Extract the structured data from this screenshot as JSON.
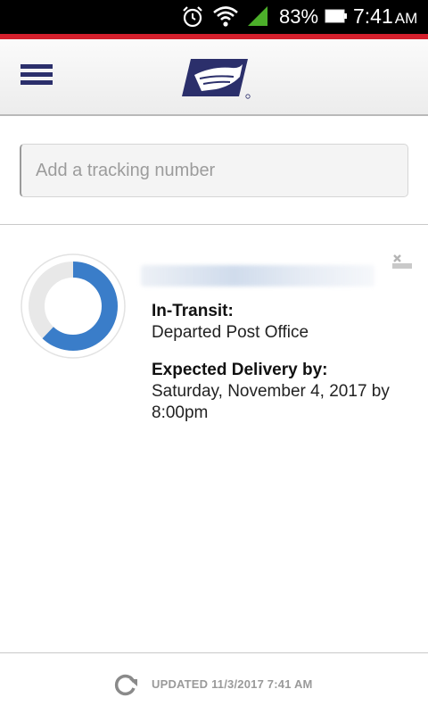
{
  "status_bar": {
    "battery_percent": "83%",
    "time": "7:41",
    "ampm": "AM",
    "icons": [
      "alarm-icon",
      "wifi-icon",
      "cell-signal-icon",
      "battery-icon"
    ]
  },
  "colors": {
    "accent_red": "#d41f2c",
    "brand_navy": "#2b2f6b",
    "progress_blue": "#3a7dc9"
  },
  "header": {
    "menu_icon": "hamburger-menu-icon",
    "logo_icon": "usps-eagle-logo-icon"
  },
  "search": {
    "placeholder": "Add a tracking number"
  },
  "package": {
    "progress_fraction": 0.62,
    "status_label": "In-Transit:",
    "status_value": "Departed Post Office",
    "delivery_label": "Expected Delivery by:",
    "delivery_date_line1": "Saturday, November 4, 2017 by",
    "delivery_date_line2": "8:00pm",
    "dismiss_icon": "dismiss-icon"
  },
  "footer": {
    "refresh_icon": "refresh-icon",
    "updated_text": "UPDATED 11/3/2017 7:41 AM"
  }
}
